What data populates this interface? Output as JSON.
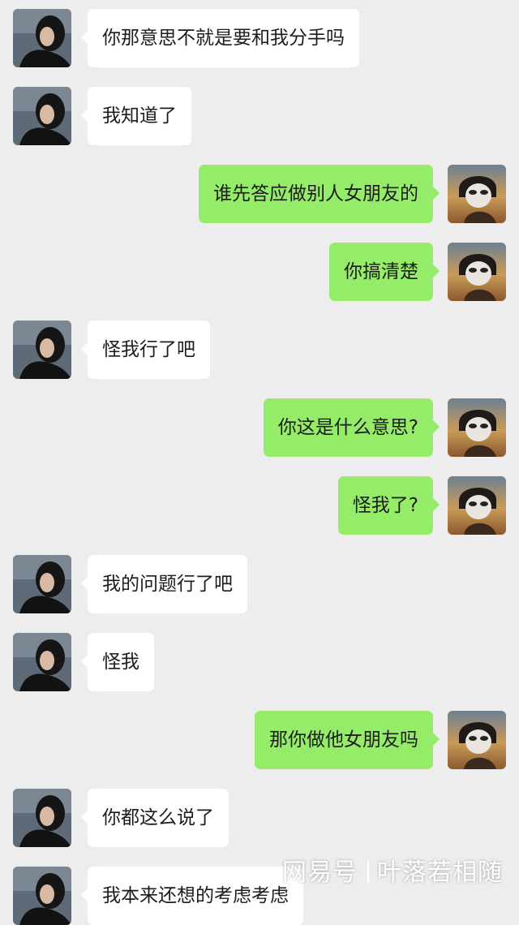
{
  "messages": [
    {
      "side": "in",
      "text": "你那意思不就是要和我分手吗"
    },
    {
      "side": "in",
      "text": "我知道了"
    },
    {
      "side": "out",
      "text": "谁先答应做别人女朋友的"
    },
    {
      "side": "out",
      "text": "你搞清楚"
    },
    {
      "side": "in",
      "text": "怪我行了吧"
    },
    {
      "side": "out",
      "text": "你这是什么意思?"
    },
    {
      "side": "out",
      "text": "怪我了?"
    },
    {
      "side": "in",
      "text": "我的问题行了吧"
    },
    {
      "side": "in",
      "text": "怪我"
    },
    {
      "side": "out",
      "text": "那你做他女朋友吗"
    },
    {
      "side": "in",
      "text": "你都这么说了"
    },
    {
      "side": "in",
      "text": "我本来还想的考虑考虑"
    }
  ],
  "watermark": {
    "platform": "网易号",
    "author": "叶落若相随"
  },
  "colors": {
    "background": "#ededed",
    "bubble_in": "#ffffff",
    "bubble_out": "#95ec69"
  },
  "icons": {
    "contact_avatar": "contact-avatar-icon",
    "self_avatar": "self-avatar-icon"
  }
}
